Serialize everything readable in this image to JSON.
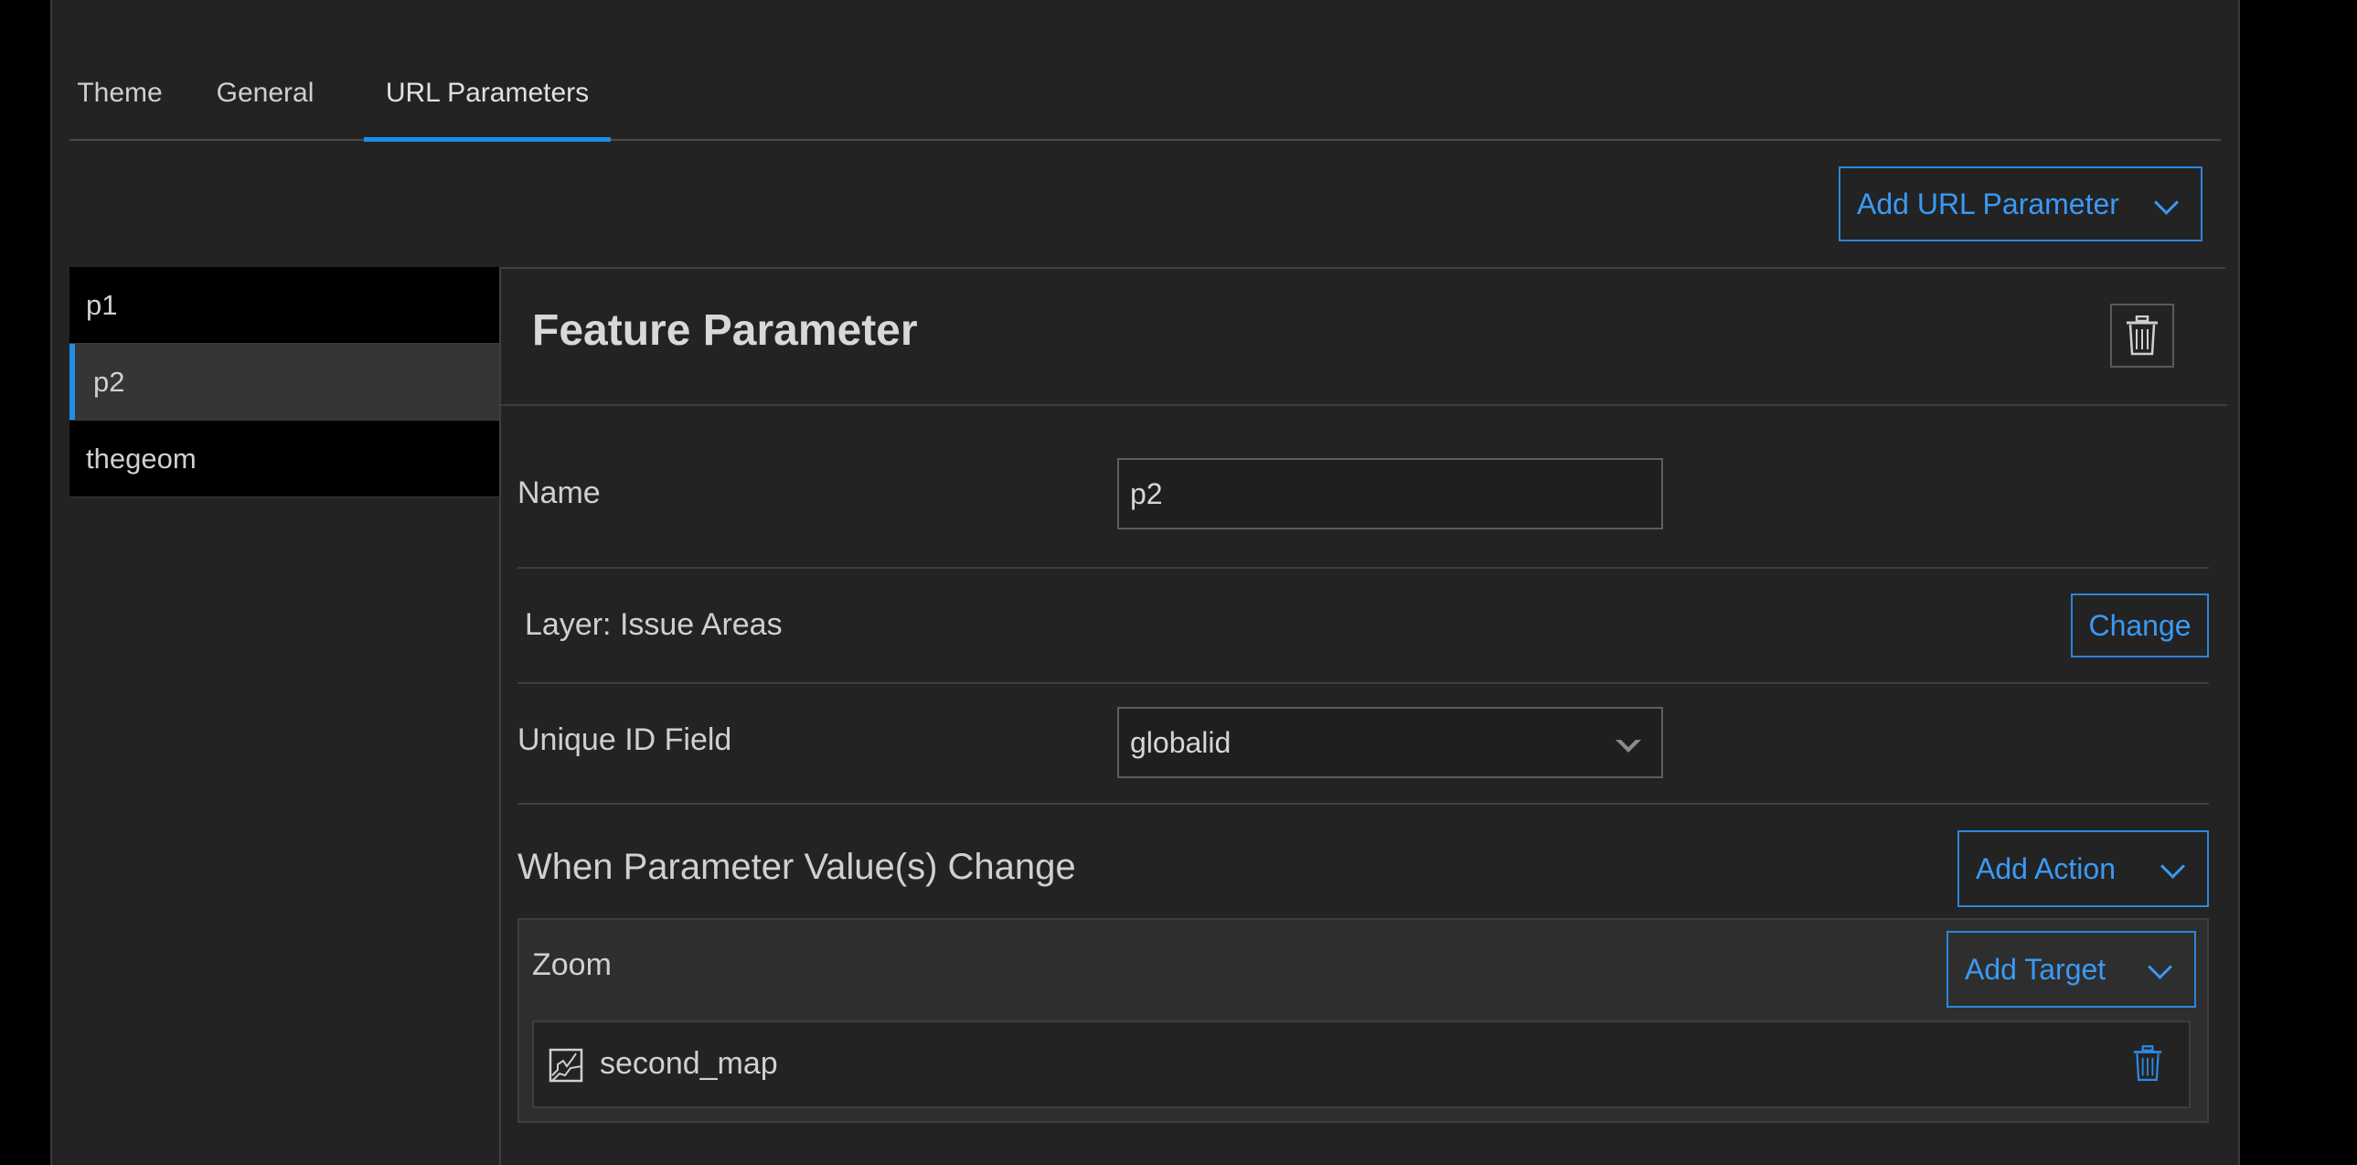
{
  "tabs": [
    {
      "label": "Theme"
    },
    {
      "label": "General"
    },
    {
      "label": "URL Parameters",
      "active": true
    }
  ],
  "add_url_parameter_label": "Add URL Parameter",
  "parameters": [
    {
      "label": "p1"
    },
    {
      "label": "p2",
      "active": true
    },
    {
      "label": "thegeom"
    }
  ],
  "detail": {
    "title": "Feature Parameter",
    "name_label": "Name",
    "name_value": "p2",
    "layer_label": "Layer: Issue Areas",
    "change_label": "Change",
    "unique_id_label": "Unique ID Field",
    "unique_id_value": "globalid",
    "when_change_label": "When Parameter Value(s) Change",
    "add_action_label": "Add Action",
    "action": {
      "name": "Zoom",
      "add_target_label": "Add Target",
      "targets": [
        {
          "label": "second_map",
          "icon": "map-icon"
        }
      ]
    }
  },
  "colors": {
    "accent": "#1e8ee6",
    "panel_bg": "#232323",
    "list_bg": "#000000"
  }
}
